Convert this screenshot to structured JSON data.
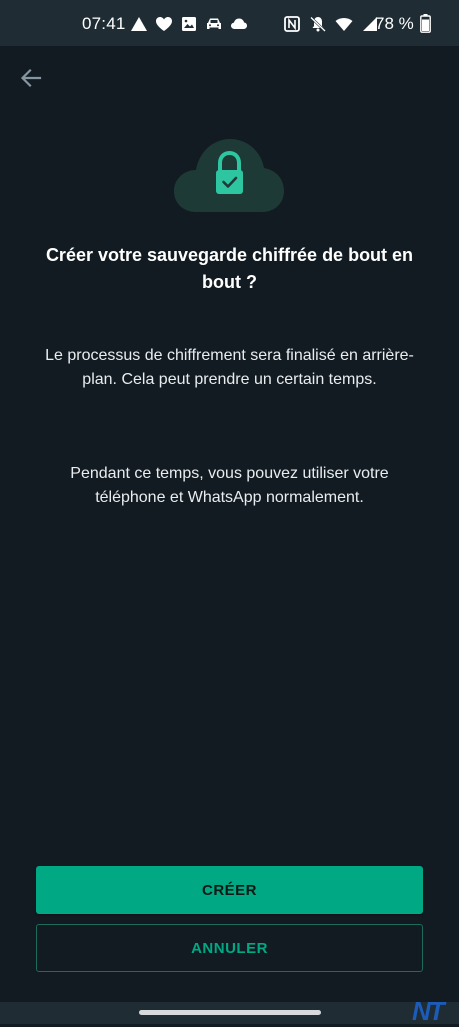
{
  "status_bar": {
    "time": "07:41",
    "battery_percent": "78 %",
    "left_icons": [
      "triangle-alert-icon",
      "heart-icon",
      "image-icon",
      "car-icon",
      "cloud-icon"
    ],
    "right_icons": [
      "nfc-icon",
      "bell-off-icon",
      "wifi-icon",
      "cell-signal-icon",
      "battery-icon"
    ]
  },
  "header": {
    "back_icon": "arrow-left-icon"
  },
  "illustration": {
    "icon": "cloud-lock-icon"
  },
  "dialog": {
    "title": "Créer votre sauvegarde chiffrée de bout en bout ?",
    "paragraph_1": "Le processus de chiffrement sera finalisé en arrière-plan. Cela peut prendre un certain temps.",
    "paragraph_2": "Pendant ce temps, vous pouvez utiliser votre téléphone et WhatsApp normalement."
  },
  "actions": {
    "create_label": "CRÉER",
    "cancel_label": "ANNULER"
  },
  "watermark": "NT",
  "colors": {
    "background": "#121b22",
    "accent": "#00a884",
    "status_bar": "#1f2c34"
  }
}
